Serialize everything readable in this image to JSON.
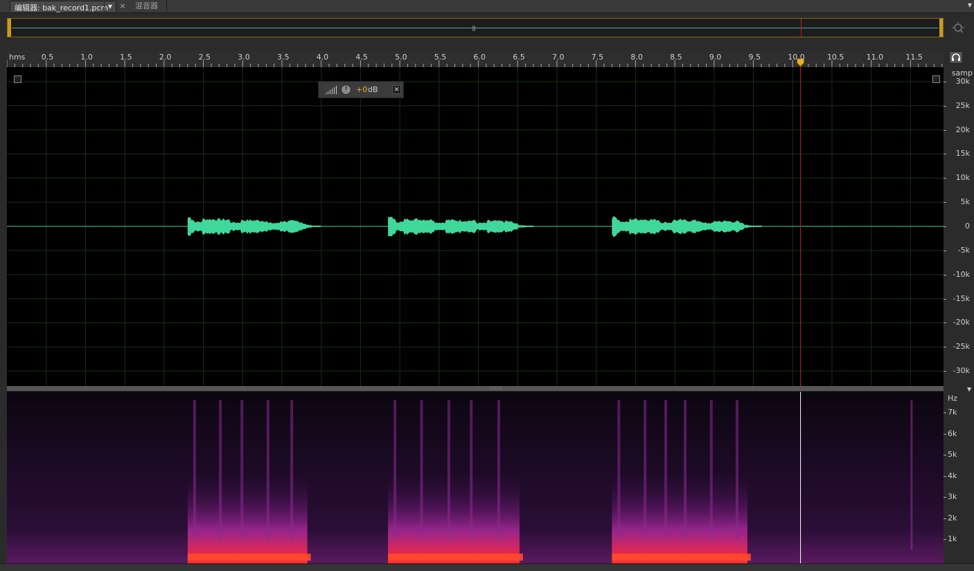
{
  "tabs": {
    "editor_label": "编辑器: bak_record1.pcm",
    "dropdown_glyph": "▼",
    "close_glyph": "×",
    "mixer_label": "混音器",
    "panel_menu_glyph": "▼"
  },
  "overview": {
    "grip_glyph": "|||"
  },
  "ruler": {
    "unit": "hms",
    "ticks": [
      "0.5",
      "1.0",
      "1.5",
      "2.0",
      "2.5",
      "3.0",
      "3.5",
      "4.0",
      "4.5",
      "5.0",
      "5.5",
      "6.0",
      "6.5",
      "7.0",
      "7.5",
      "8.0",
      "8.5",
      "9.0",
      "9.5",
      "10.0",
      "10.5",
      "11.0",
      "11.5"
    ],
    "playhead_time_s": 10.1
  },
  "hud": {
    "gain_value": "+0",
    "gain_unit": "dB",
    "pin_glyph": "✕"
  },
  "amplitude_axis": {
    "unit": "samp",
    "labels": [
      "30k",
      "25k",
      "20k",
      "15k",
      "10k",
      "5k",
      "0",
      "-5k",
      "-10k",
      "-15k",
      "-20k",
      "-25k",
      "-30k"
    ]
  },
  "frequency_axis": {
    "unit": "Hz",
    "labels": [
      "7k",
      "6k",
      "5k",
      "4k",
      "3k",
      "2k",
      "1k"
    ]
  },
  "splitter": {
    "grip_glyph": "::::::::"
  },
  "colors": {
    "waveform": "#3fd89a",
    "playhead": "#c02020",
    "overview_border": "#c89b22",
    "spec_low": "#1a0a26",
    "spec_mid": "#b02aa0",
    "spec_high": "#ff3030"
  },
  "waveform_segments_s": [
    [
      2.3,
      4.0
    ],
    [
      4.85,
      6.7
    ],
    [
      7.7,
      9.6
    ]
  ]
}
